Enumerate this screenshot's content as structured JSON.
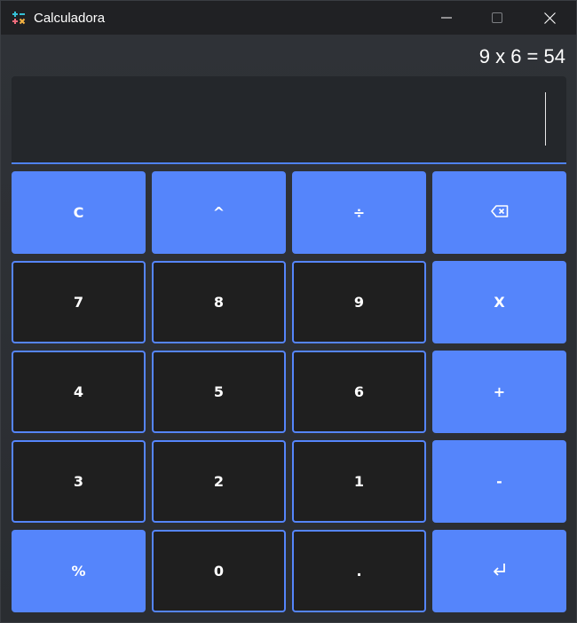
{
  "window": {
    "title": "Calculadora",
    "app_icon": "calculator-icon",
    "controls": [
      "minimize-icon",
      "maximize-icon",
      "close-icon"
    ]
  },
  "history": {
    "expression": "9 x 6 = 54"
  },
  "display": {
    "value": ""
  },
  "keypad": {
    "clear": "C",
    "power": "^",
    "divide": "÷",
    "backspace": "⌫",
    "seven": "7",
    "eight": "8",
    "nine": "9",
    "multiply": "X",
    "four": "4",
    "five": "5",
    "six": "6",
    "plus": "+",
    "three": "3",
    "two": "2",
    "one": "1",
    "minus": "-",
    "percent": "%",
    "zero": "0",
    "decimal": ".",
    "enter": "⏎"
  },
  "colors": {
    "accent": "#5585fb",
    "key_dark": "#1f1f1f",
    "background": "#2b2e33",
    "titlebar": "#202124"
  }
}
